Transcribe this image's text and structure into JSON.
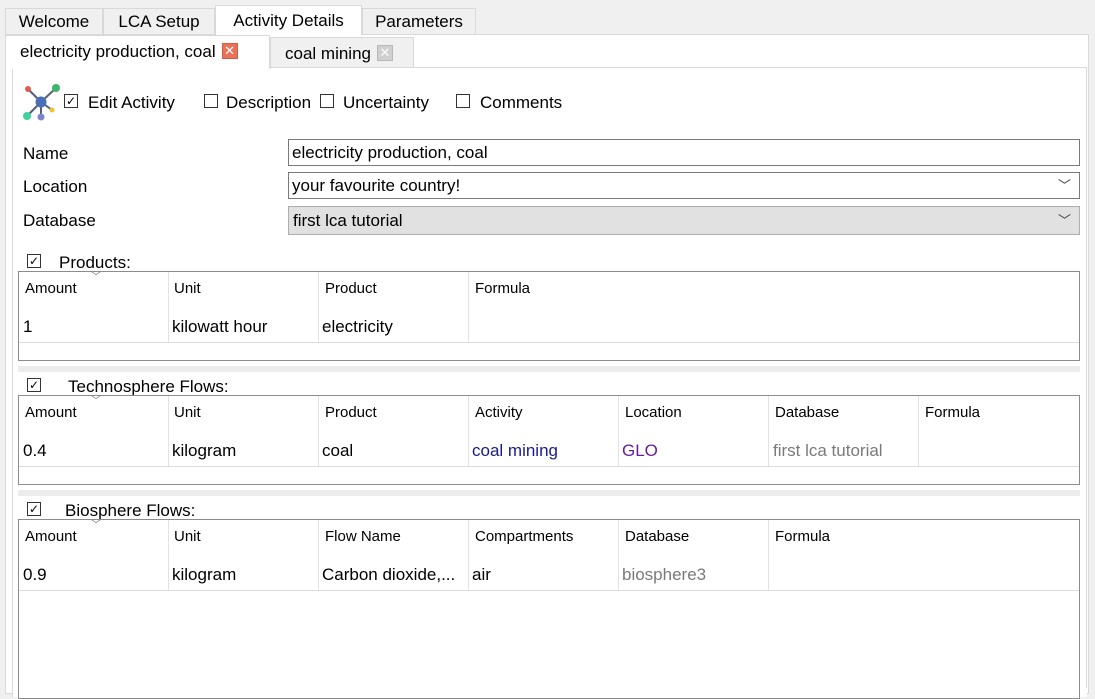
{
  "top_tabs": [
    {
      "label": "Welcome",
      "active": false
    },
    {
      "label": "LCA Setup",
      "active": false
    },
    {
      "label": "Activity Details",
      "active": true
    },
    {
      "label": "Parameters",
      "active": false
    }
  ],
  "activity_tabs": [
    {
      "label": "electricity production, coal",
      "active": true,
      "close_icon": "close-icon-red"
    },
    {
      "label": "coal mining",
      "active": false,
      "close_icon": "close-icon-grey"
    }
  ],
  "toolbar": {
    "app_icon": "graph-network-icon",
    "checkboxes": [
      {
        "label": "Edit Activity",
        "checked": true
      },
      {
        "label": "Description",
        "checked": false
      },
      {
        "label": "Uncertainty",
        "checked": false
      },
      {
        "label": "Comments",
        "checked": false
      }
    ]
  },
  "form": {
    "name_label": "Name",
    "name_value": "electricity production, coal",
    "location_label": "Location",
    "location_value": "your favourite country!",
    "database_label": "Database",
    "database_value": "first lca tutorial"
  },
  "products": {
    "title": "Products:",
    "checked": true,
    "columns": [
      "Amount",
      "Unit",
      "Product",
      "Formula"
    ],
    "rows": [
      {
        "amount": "1",
        "unit": "kilowatt hour",
        "product": "electricity",
        "formula": ""
      }
    ]
  },
  "technosphere": {
    "title": "Technosphere Flows:",
    "checked": true,
    "columns": [
      "Amount",
      "Unit",
      "Product",
      "Activity",
      "Location",
      "Database",
      "Formula"
    ],
    "rows": [
      {
        "amount": "0.4",
        "unit": "kilogram",
        "product": "coal",
        "activity": "coal mining",
        "location": "GLO",
        "database": "first lca tutorial",
        "formula": ""
      }
    ]
  },
  "biosphere": {
    "title": "Biosphere Flows:",
    "checked": true,
    "columns": [
      "Amount",
      "Unit",
      "Flow Name",
      "Compartments",
      "Database",
      "Formula"
    ],
    "rows": [
      {
        "amount": "0.9",
        "unit": "kilogram",
        "flow_name": "Carbon dioxide,...",
        "compartments": "air",
        "database": "biosphere3",
        "formula": ""
      }
    ]
  },
  "colors": {
    "link_blue": "#1a1a8c",
    "link_purple": "#6b1a9c",
    "muted": "#7a7a7a",
    "close_red": "#e8735a"
  }
}
